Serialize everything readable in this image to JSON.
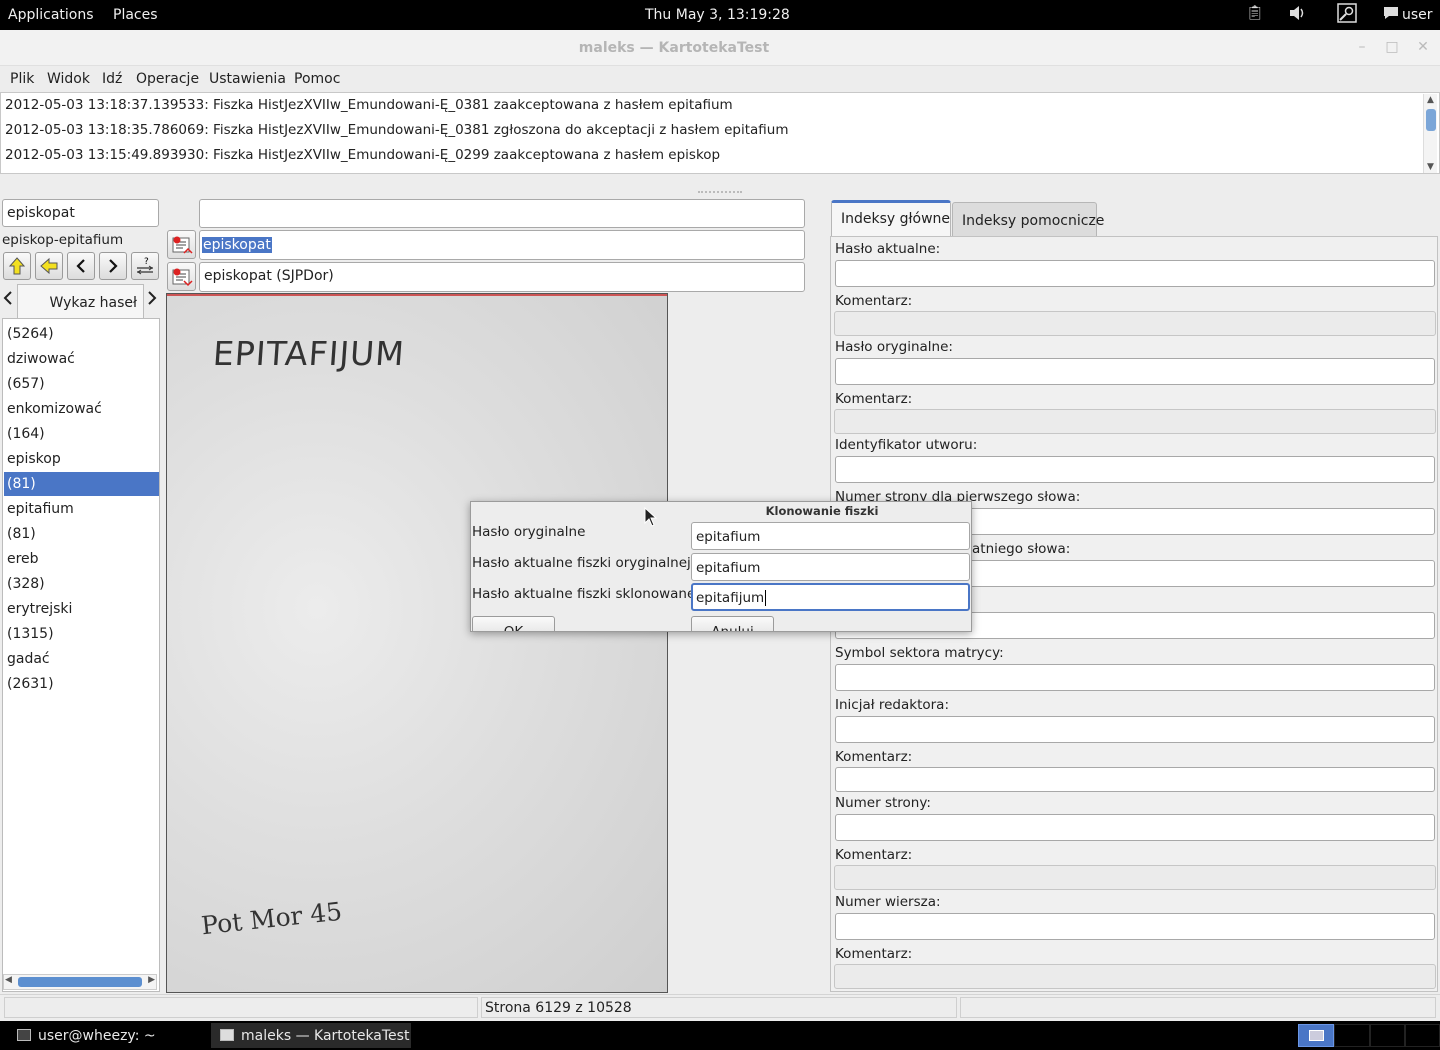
{
  "top_panel": {
    "applications": "Applications",
    "places": "Places",
    "clock": "Thu May  3, 13:19:28",
    "user": "user"
  },
  "window": {
    "title": "maleks — KartotekaTest"
  },
  "menu": [
    "Plik",
    "Widok",
    "Idź",
    "Operacje",
    "Ustawienia",
    "Pomoc"
  ],
  "log": [
    "2012-05-03 13:18:37.139533: Fiszka HistJezXVIIw_Emundowani-Ę_0381 zaakceptowana z hasłem epitafium",
    "2012-05-03 13:18:35.786069: Fiszka HistJezXVIIw_Emundowani-Ę_0381 zgłoszona do akceptacji z hasłem epitafium",
    "2012-05-03 13:15:49.893930: Fiszka HistJezXVIIw_Emundowani-Ę_0299 zaakceptowana z hasłem episkop"
  ],
  "left": {
    "search_value": "episkopat",
    "range_label": "episkop-epitafium",
    "tab_label": "Wykaz haseł",
    "entries": [
      "(5264)",
      "dziwować",
      "(657)",
      "enkomizować",
      "(164)",
      "episkop",
      "(81)",
      "epitafium",
      "(81)",
      "ereb",
      "(328)",
      "erytrejski",
      "(1315)",
      "gadać",
      "(2631)"
    ],
    "selected_index": 6
  },
  "center": {
    "top_field": "",
    "field_selected": "episkopat",
    "field_suggestion": "episkopat (SJPDor)"
  },
  "scan": {
    "headword": "EPITAFIJUM",
    "footnote": "Pot Mor 45"
  },
  "right": {
    "tabs": [
      "Indeksy główne",
      "Indeksy pomocnicze"
    ],
    "labels": {
      "haslo_aktualne": "Hasło aktualne:",
      "komentarz": "Komentarz:",
      "haslo_oryginalne": "Hasło oryginalne:",
      "identyfikator": "Identyfikator utworu:",
      "numer_pierwszego": "Numer strony dla pierwszego słowa:",
      "numer_ostatniego_tail": "atniego słowa:",
      "symbol_sektora": "Symbol sektora matrycy:",
      "inicjal": "Inicjał redaktora:",
      "numer_strony": "Numer strony:",
      "numer_wiersza": "Numer wiersza:"
    }
  },
  "dialog": {
    "title": "Klonowanie fiszki",
    "label_orig": "Hasło oryginalne",
    "label_actual_orig": "Hasło aktualne fiszki oryginalnej",
    "label_actual_clone": "Hasło aktualne fiszki sklonowanej",
    "value_orig": "epitafium",
    "value_actual_orig": "epitafium",
    "value_actual_clone": "epitafijum",
    "ok": "OK",
    "cancel": "Anuluj"
  },
  "status": {
    "page": "Strona 6129 z 10528"
  },
  "taskbar": {
    "terminal": "user@wheezy: ~",
    "app": "maleks — KartotekaTest"
  },
  "colors": {
    "selection": "#4a76c6",
    "panel": "#000000"
  }
}
